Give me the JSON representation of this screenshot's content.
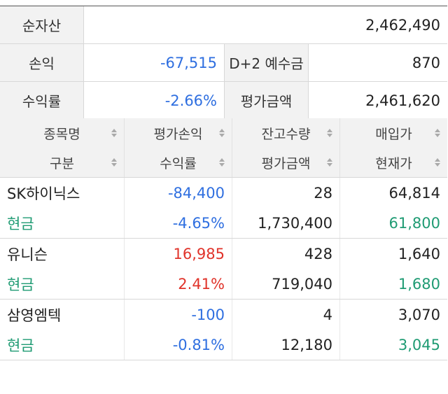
{
  "summary": {
    "net_assets_label": "순자산",
    "net_assets_value": "2,462,490",
    "pnl_label": "손익",
    "pnl_value": "-67,515",
    "deposit_label": "D+2 예수금",
    "deposit_value": "870",
    "return_label": "수익률",
    "return_value": "-2.66%",
    "eval_label": "평가금액",
    "eval_value": "2,461,620"
  },
  "header": {
    "col1_top": "종목명",
    "col1_bottom": "구분",
    "col2_top": "평가손익",
    "col2_bottom": "수익률",
    "col3_top": "잔고수량",
    "col3_bottom": "평가금액",
    "col4_top": "매입가",
    "col4_bottom": "현재가"
  },
  "holdings": [
    {
      "name": "SK하이닉스",
      "type": "현금",
      "pnl": "-84,400",
      "return_rate": "-4.65%",
      "quantity": "28",
      "eval_amount": "1,730,400",
      "buy_price": "64,814",
      "current_price": "61,800"
    },
    {
      "name": "유니슨",
      "type": "현금",
      "pnl": "16,985",
      "return_rate": "2.41%",
      "quantity": "428",
      "eval_amount": "719,040",
      "buy_price": "1,640",
      "current_price": "1,680"
    },
    {
      "name": "삼영엠텍",
      "type": "현금",
      "pnl": "-100",
      "return_rate": "-0.81%",
      "quantity": "4",
      "eval_amount": "12,180",
      "buy_price": "3,070",
      "current_price": "3,045"
    }
  ],
  "colors": {
    "negative": "#2f6fe0",
    "positive": "#e0332a",
    "cash": "#1f9b73"
  }
}
